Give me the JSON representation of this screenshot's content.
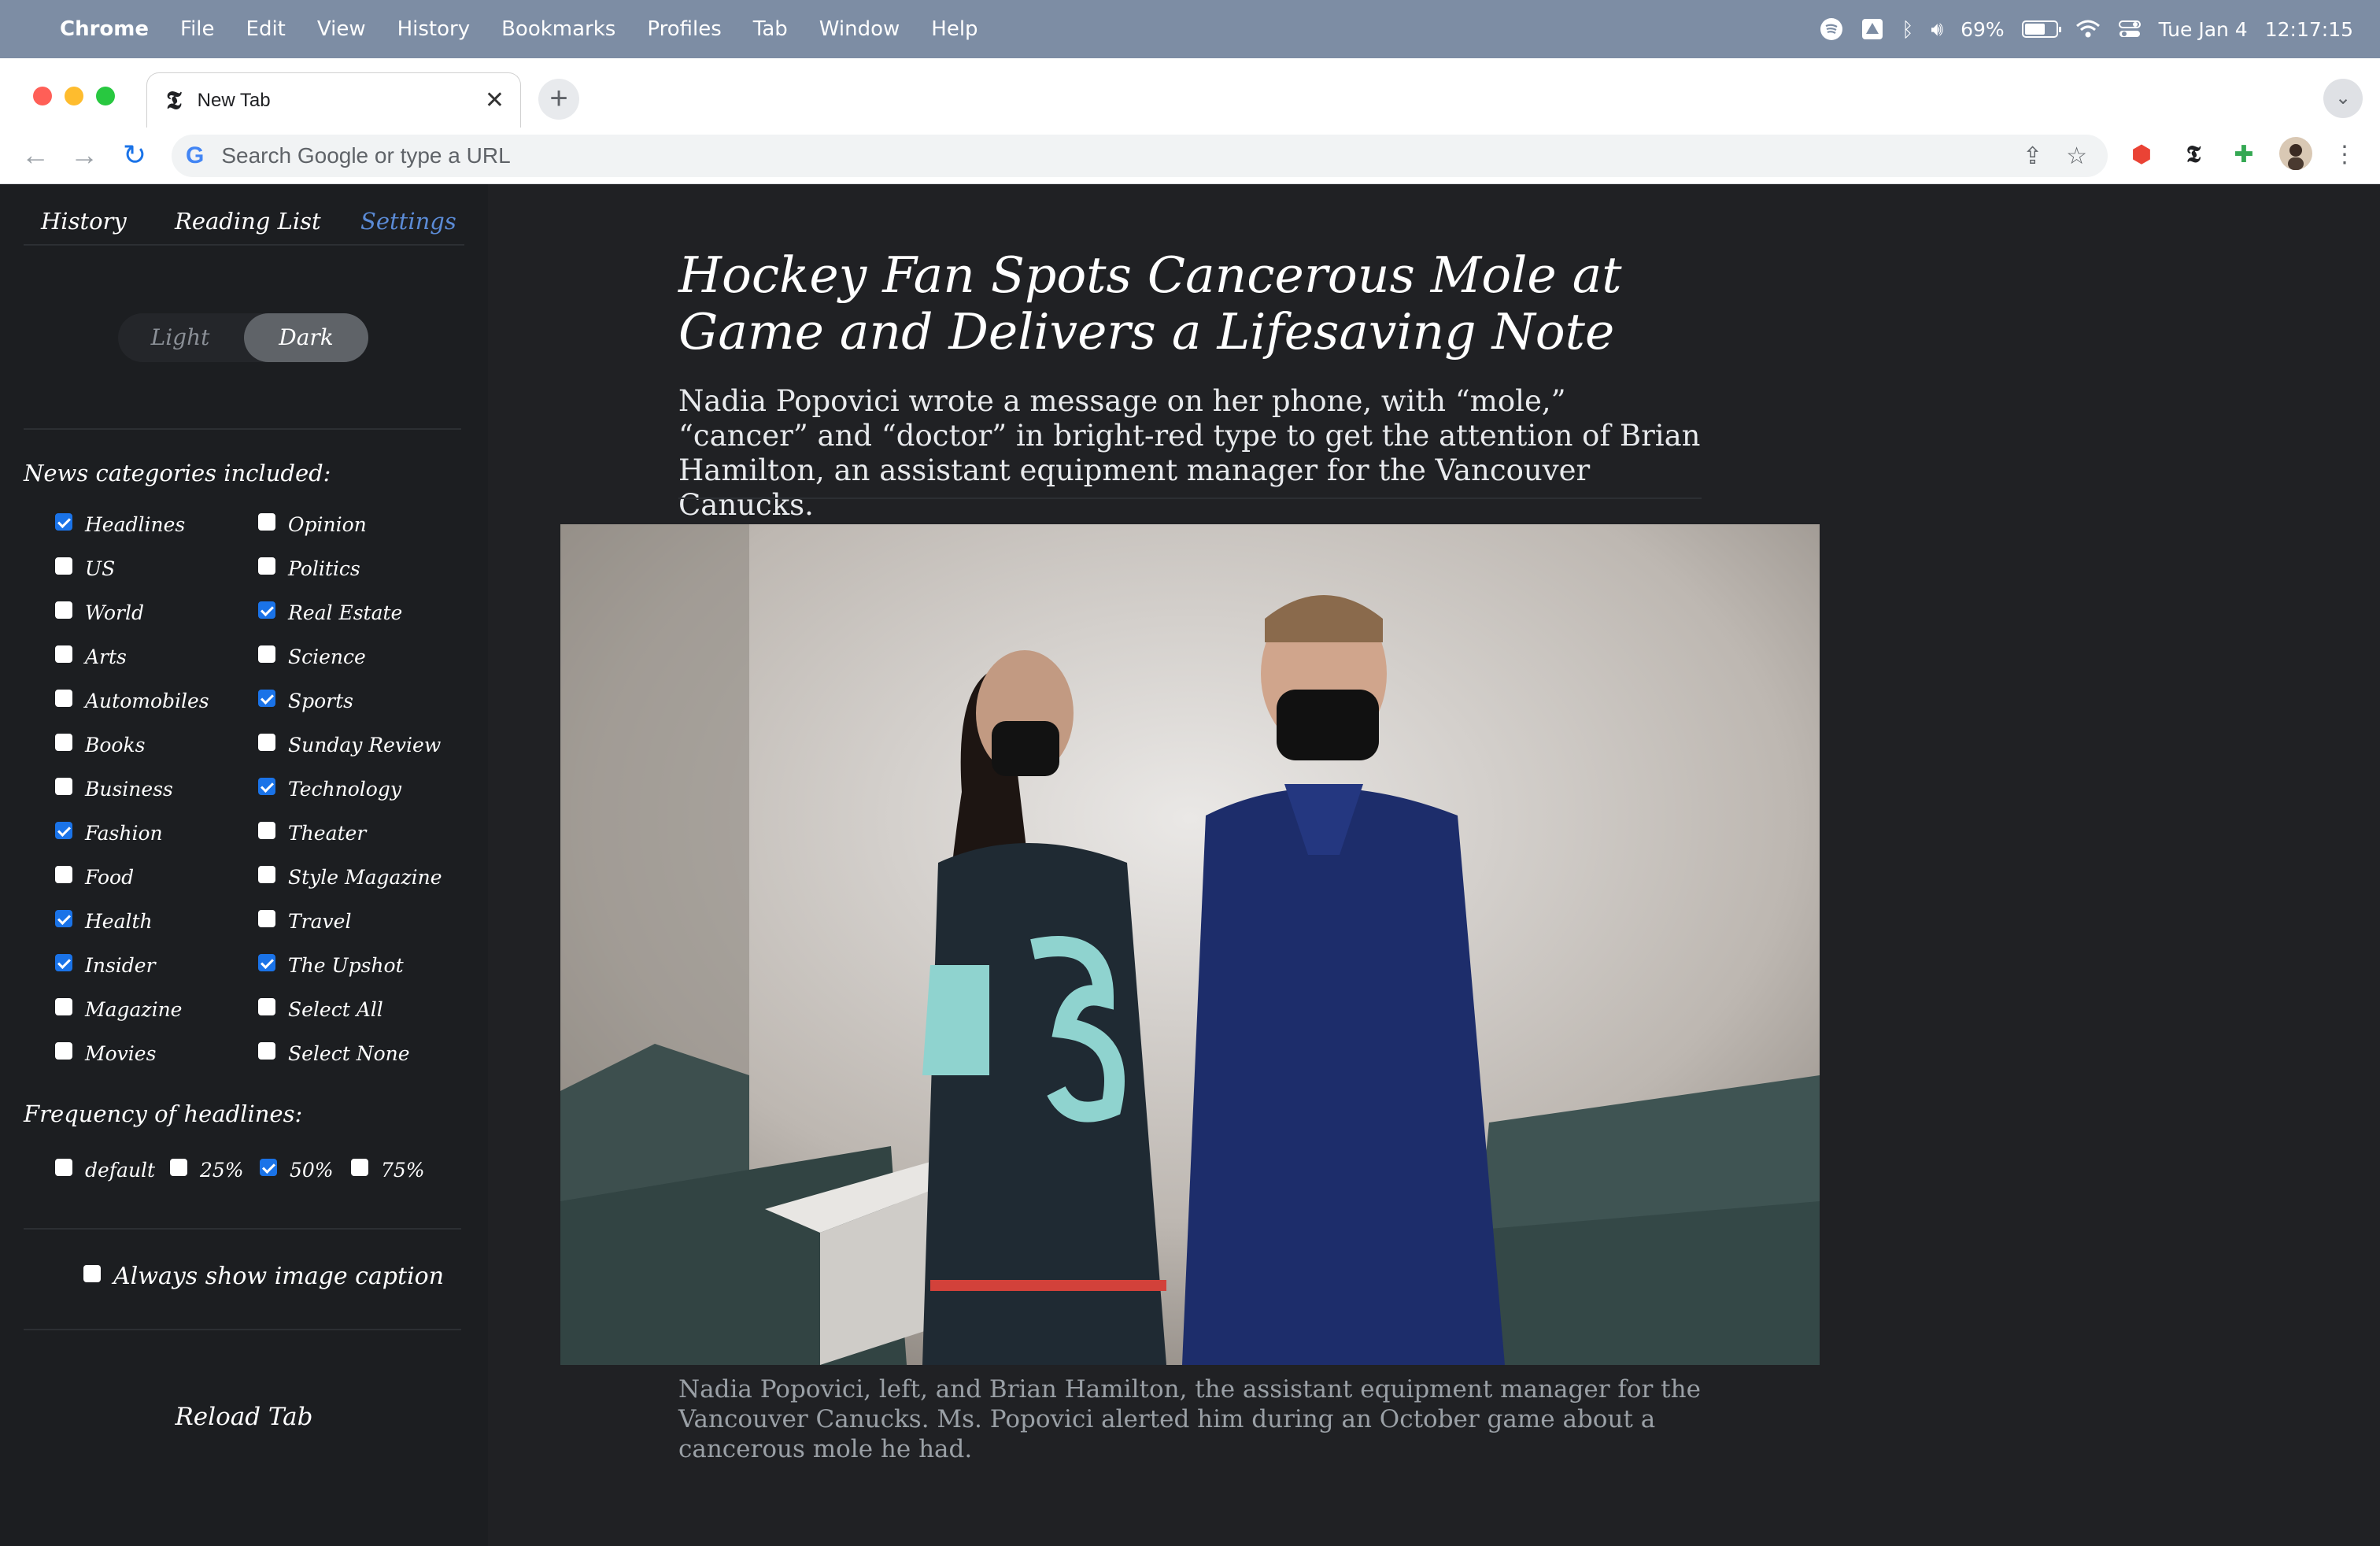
{
  "menubar": {
    "app_name": "Chrome",
    "items": [
      "File",
      "Edit",
      "View",
      "History",
      "Bookmarks",
      "Profiles",
      "Tab",
      "Window",
      "Help"
    ],
    "battery": "69%",
    "date": "Tue Jan 4",
    "time": "12:17:15"
  },
  "browser": {
    "tab_title": "New Tab",
    "omnibox_placeholder": "Search Google or type a URL"
  },
  "sidebar": {
    "tabs": [
      "History",
      "Reading List",
      "Settings"
    ],
    "active_tab": "Settings",
    "theme": {
      "light_label": "Light",
      "dark_label": "Dark",
      "selected": "Dark"
    },
    "categories_label": "News categories included:",
    "categories_left": [
      {
        "label": "Headlines",
        "checked": true
      },
      {
        "label": "US",
        "checked": false
      },
      {
        "label": "World",
        "checked": false
      },
      {
        "label": "Arts",
        "checked": false
      },
      {
        "label": "Automobiles",
        "checked": false
      },
      {
        "label": "Books",
        "checked": false
      },
      {
        "label": "Business",
        "checked": false
      },
      {
        "label": "Fashion",
        "checked": true
      },
      {
        "label": "Food",
        "checked": false
      },
      {
        "label": "Health",
        "checked": true
      },
      {
        "label": "Insider",
        "checked": true
      },
      {
        "label": "Magazine",
        "checked": false
      },
      {
        "label": "Movies",
        "checked": false
      }
    ],
    "categories_right": [
      {
        "label": "Opinion",
        "checked": false
      },
      {
        "label": "Politics",
        "checked": false
      },
      {
        "label": "Real Estate",
        "checked": true
      },
      {
        "label": "Science",
        "checked": false
      },
      {
        "label": "Sports",
        "checked": true
      },
      {
        "label": "Sunday Review",
        "checked": false
      },
      {
        "label": "Technology",
        "checked": true
      },
      {
        "label": "Theater",
        "checked": false
      },
      {
        "label": "Style Magazine",
        "checked": false
      },
      {
        "label": "Travel",
        "checked": false
      },
      {
        "label": "The Upshot",
        "checked": true
      },
      {
        "label": "Select All",
        "checked": false
      },
      {
        "label": "Select None",
        "checked": false
      }
    ],
    "frequency_label": "Frequency of headlines:",
    "frequency_options": [
      {
        "label": "default",
        "checked": false
      },
      {
        "label": "25%",
        "checked": false
      },
      {
        "label": "50%",
        "checked": true
      },
      {
        "label": "75%",
        "checked": false
      }
    ],
    "caption_option": {
      "label": "Always show image caption",
      "checked": false
    },
    "reload_label": "Reload Tab"
  },
  "article": {
    "headline": "Hockey Fan Spots Cancerous Mole at Game and Delivers a Lifesaving Note",
    "summary": "Nadia Popovici wrote a message on her phone, with “mole,” “cancer” and “doctor” in bright-red type to get the attention of Brian Hamilton, an assistant equipment manager for the Vancouver Canucks.",
    "caption": "Nadia Popovici, left, and Brian Hamilton, the assistant equipment manager for the Vancouver Canucks. Ms. Popovici alerted him during an October game about a cancerous mole he had."
  }
}
